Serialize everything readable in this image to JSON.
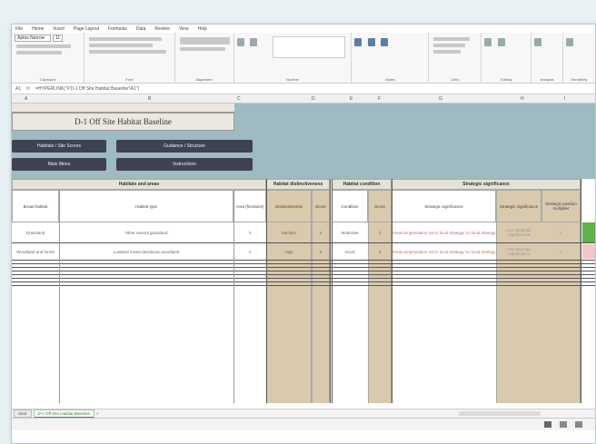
{
  "menu": [
    "File",
    "Home",
    "Insert",
    "Page Layout",
    "Formulas",
    "Data",
    "Review",
    "View",
    "Help"
  ],
  "ribbon": {
    "font_name": "Aptos Narrow",
    "font_size": "11",
    "groups": [
      "Clipboard",
      "Font",
      "Alignment",
      "Number",
      "Styles",
      "Cells",
      "Editing",
      "Analysis",
      "Sensitivity"
    ]
  },
  "formula_bar": {
    "cell_ref": "A1",
    "fx": "fx",
    "value": "=HYPERLINK(\"#'D-1 Off Site Habitat Baseline'!A1\")"
  },
  "columns": [
    "A",
    "B",
    "C",
    "D",
    "E",
    "F",
    "G",
    "H",
    "I"
  ],
  "sheet": {
    "title": "D-1 Off Site Habitat Baseline",
    "buttons": [
      "Habitats / Site Scores",
      "Guidance / Structure",
      "Main Menu",
      "Instructions"
    ]
  },
  "table": {
    "groups": [
      "Habitats and areas",
      "Habitat distinctiveness",
      "Habitat condition",
      "Strategic significance"
    ],
    "headers": [
      "Broad habitat",
      "Habitat type",
      "Area (hectares)",
      "Distinctiveness",
      "Score",
      "Condition",
      "Score",
      "Strategic significance",
      "Strategic significance",
      "Strategic position multiplier"
    ],
    "rows": [
      [
        "Grassland",
        "Other neutral grassland",
        "2",
        "Medium",
        "4",
        "Moderate",
        "2",
        "Area/compensation not in local strategy/ no local strategy",
        "Low Strategic Significance",
        "1"
      ],
      [
        "Woodland and forest",
        "Lowland mixed deciduous woodland",
        "1",
        "High",
        "6",
        "Good",
        "3",
        "Area/compensation not in local strategy/ no local strategy",
        "Low Strategic Significance",
        "1"
      ]
    ]
  },
  "tabs": [
    "Start",
    "D-1 Off Site Habitat Baseline",
    "+"
  ],
  "colors": {
    "banner": "#9ebbc2",
    "tan": "#d9c9ad",
    "button": "#3f4250",
    "active_tab": "#2e7a2e"
  }
}
